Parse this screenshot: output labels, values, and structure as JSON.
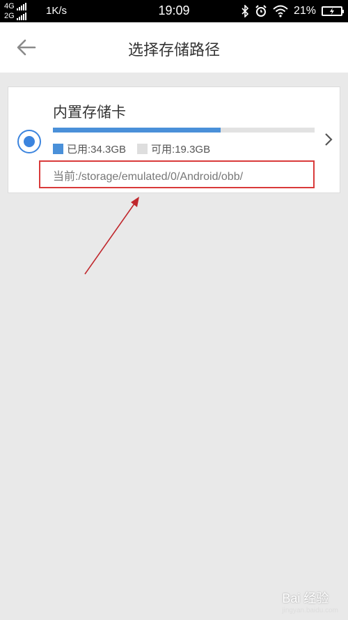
{
  "status_bar": {
    "net1": "4G",
    "net2": "2G",
    "speed": "1K/s",
    "time": "19:09",
    "battery": "21%"
  },
  "header": {
    "title": "选择存储路径",
    "back_icon": "back-arrow-icon"
  },
  "storage": {
    "name": "内置存储卡",
    "used_label": "已用:34.3GB",
    "free_label": "可用:19.3GB",
    "used_fraction": 0.64,
    "current_path": "当前:/storage/emulated/0/Android/obb/",
    "selected": true
  },
  "watermark": {
    "brand": "Bai 经验",
    "url": "jingyan.baidu.com"
  },
  "colors": {
    "accent": "#4a90d9",
    "highlight": "#d93a3a"
  }
}
